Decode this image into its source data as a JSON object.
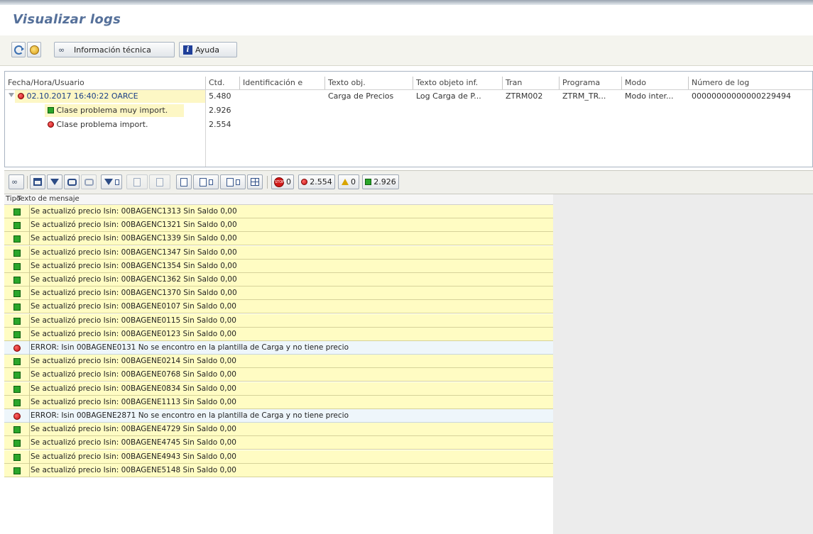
{
  "window": {
    "title": "Visualizar logs"
  },
  "app_toolbar": {
    "refresh_icon": "refresh-icon",
    "coin_icon": "coin-icon",
    "tech_info_label": "Información técnica",
    "help_label": "Ayuda"
  },
  "log_header": {
    "columns": [
      "Fecha/Hora/Usuario",
      "Ctd.",
      "Identificación e",
      "Texto obj.",
      "Texto objeto inf.",
      "Tran",
      "Programa",
      "Modo",
      "Número de log"
    ],
    "main_row": {
      "datetime_user": "02.10.2017  16:40:22  OARCE",
      "count": "5.480",
      "identification": "",
      "object_text": "Carga de Precios",
      "subobject_text": "Log Carga de P...",
      "transaction": "ZTRM002",
      "program": "ZTRM_TR...",
      "mode": "Modo inter...",
      "log_number": "00000000000000229494"
    },
    "children": [
      {
        "label": "Clase problema muy import.",
        "count": "2.926",
        "status": "success"
      },
      {
        "label": "Clase problema import.",
        "count": "2.554",
        "status": "error"
      }
    ]
  },
  "message_toolbar": {
    "stop_count": "0",
    "error_count": "2.554",
    "warning_count": "0",
    "success_count": "2.926"
  },
  "messages": {
    "columns": {
      "type": "Tipo",
      "text": "Texto de mensaje"
    },
    "rows": [
      {
        "status": "success",
        "text": "Se actualizó precio Isin: 00BAGENC1313 Sin Saldo 0,00"
      },
      {
        "status": "success",
        "text": "Se actualizó precio Isin: 00BAGENC1321 Sin Saldo 0,00"
      },
      {
        "status": "success",
        "text": "Se actualizó precio Isin: 00BAGENC1339 Sin Saldo 0,00"
      },
      {
        "status": "success",
        "text": "Se actualizó precio Isin: 00BAGENC1347 Sin Saldo 0,00"
      },
      {
        "status": "success",
        "text": "Se actualizó precio Isin: 00BAGENC1354 Sin Saldo 0,00"
      },
      {
        "status": "success",
        "text": "Se actualizó precio Isin: 00BAGENC1362 Sin Saldo 0,00"
      },
      {
        "status": "success",
        "text": "Se actualizó precio Isin: 00BAGENC1370 Sin Saldo 0,00"
      },
      {
        "status": "success",
        "text": "Se actualizó precio Isin: 00BAGENE0107 Sin Saldo 0,00"
      },
      {
        "status": "success",
        "text": "Se actualizó precio Isin: 00BAGENE0115 Sin Saldo 0,00"
      },
      {
        "status": "success",
        "text": "Se actualizó precio Isin: 00BAGENE0123 Sin Saldo 0,00"
      },
      {
        "status": "error",
        "text": "ERROR: Isin 00BAGENE0131 No se encontro en la plantilla de Carga y no tiene precio"
      },
      {
        "status": "success",
        "text": "Se actualizó precio Isin: 00BAGENE0214 Sin Saldo 0,00"
      },
      {
        "status": "success",
        "text": "Se actualizó precio Isin: 00BAGENE0768 Sin Saldo 0,00"
      },
      {
        "status": "success",
        "text": "Se actualizó precio Isin: 00BAGENE0834 Sin Saldo 0,00"
      },
      {
        "status": "success",
        "text": "Se actualizó precio Isin: 00BAGENE1113 Sin Saldo 0,00"
      },
      {
        "status": "error",
        "text": "ERROR: Isin 00BAGENE2871 No se encontro en la plantilla de Carga y no tiene precio"
      },
      {
        "status": "success",
        "text": "Se actualizó precio Isin: 00BAGENE4729 Sin Saldo 0,00"
      },
      {
        "status": "success",
        "text": "Se actualizó precio Isin: 00BAGENE4745 Sin Saldo 0,00"
      },
      {
        "status": "success",
        "text": "Se actualizó precio Isin: 00BAGENE4943 Sin Saldo 0,00"
      },
      {
        "status": "success",
        "text": "Se actualizó precio Isin: 00BAGENE5148 Sin Saldo 0,00"
      }
    ]
  }
}
